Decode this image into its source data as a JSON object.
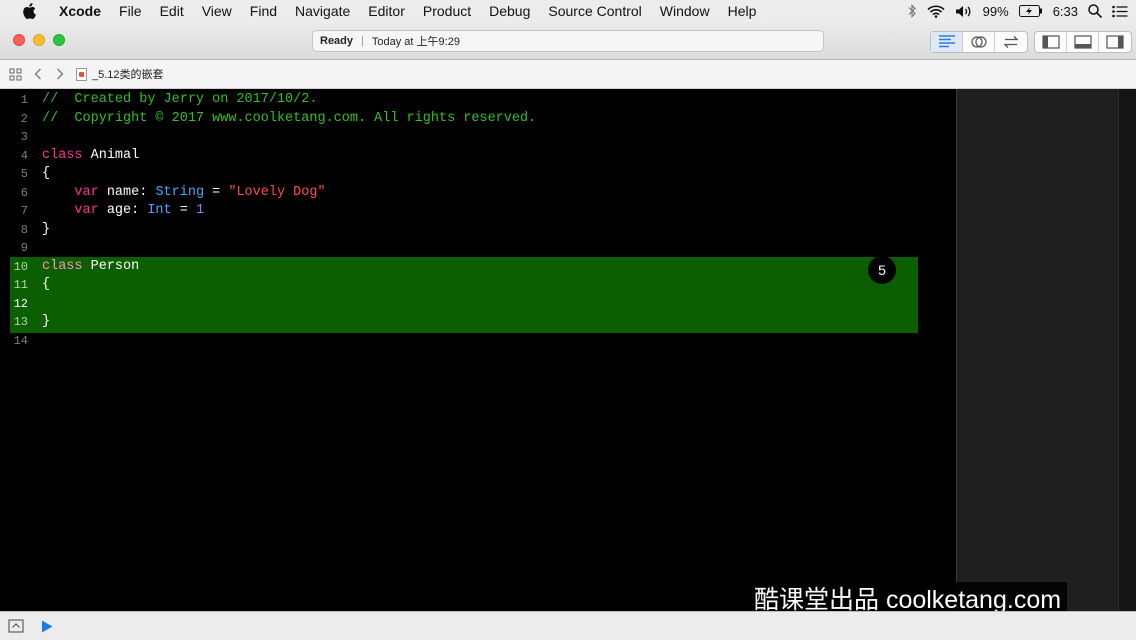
{
  "menubar": {
    "app_name": "Xcode",
    "items": [
      "File",
      "Edit",
      "View",
      "Find",
      "Navigate",
      "Editor",
      "Product",
      "Debug",
      "Source Control",
      "Window",
      "Help"
    ],
    "battery": "99%",
    "time": "6:33",
    "icons": [
      "apple-icon",
      "bluetooth-icon",
      "wifi-icon",
      "volume-icon",
      "battery-icon",
      "spotlight-icon",
      "notification-center-icon"
    ]
  },
  "toolbar": {
    "status": "Ready",
    "timestamp": "Today at 上午9:29",
    "editor_modes": [
      "standard-editor-icon",
      "assistant-editor-icon",
      "version-editor-icon"
    ],
    "panels": [
      "navigator-panel-icon",
      "debug-area-icon",
      "utilities-panel-icon"
    ]
  },
  "jumpbar": {
    "filename": "_5.12类的嵌套"
  },
  "editor": {
    "badge": "5",
    "lines": [
      {
        "n": "1",
        "tokens": [
          {
            "c": "cm",
            "t": "//  Created by Jerry on 2017/10/2."
          }
        ]
      },
      {
        "n": "2",
        "tokens": [
          {
            "c": "cm",
            "t": "//  Copyright © 2017 www.coolketang.com. All rights reserved."
          }
        ]
      },
      {
        "n": "3",
        "tokens": []
      },
      {
        "n": "4",
        "tokens": [
          {
            "c": "kw",
            "t": "class"
          },
          {
            "c": "",
            "t": " Animal"
          }
        ]
      },
      {
        "n": "5",
        "tokens": [
          {
            "c": "",
            "t": "{"
          }
        ]
      },
      {
        "n": "6",
        "tokens": [
          {
            "c": "",
            "t": "    "
          },
          {
            "c": "kw",
            "t": "var"
          },
          {
            "c": "",
            "t": " name: "
          },
          {
            "c": "ty",
            "t": "String"
          },
          {
            "c": "",
            "t": " = "
          },
          {
            "c": "st",
            "t": "\"Lovely Dog\""
          }
        ]
      },
      {
        "n": "7",
        "tokens": [
          {
            "c": "",
            "t": "    "
          },
          {
            "c": "kw",
            "t": "var"
          },
          {
            "c": "",
            "t": " age: "
          },
          {
            "c": "ty",
            "t": "Int"
          },
          {
            "c": "",
            "t": " = "
          },
          {
            "c": "nm",
            "t": "1"
          }
        ]
      },
      {
        "n": "8",
        "tokens": [
          {
            "c": "",
            "t": "}"
          }
        ]
      },
      {
        "n": "9",
        "tokens": []
      },
      {
        "n": "10",
        "hl": true,
        "tokens": [
          {
            "c": "kw-hl",
            "t": "class"
          },
          {
            "c": "",
            "t": " Person"
          }
        ]
      },
      {
        "n": "11",
        "hl": true,
        "tokens": [
          {
            "c": "",
            "t": "{"
          }
        ]
      },
      {
        "n": "12",
        "hl": true,
        "cur": true,
        "tokens": []
      },
      {
        "n": "13",
        "hl": true,
        "tokens": [
          {
            "c": "",
            "t": "}"
          }
        ]
      },
      {
        "n": "14",
        "tokens": []
      }
    ]
  },
  "watermark": "酷课堂出品 coolketang.com",
  "colors": {
    "highlight": "#0b5f00",
    "keyword": "#ff2f96",
    "comment": "#30c020",
    "type": "#3fa8ff",
    "string": "#ff4a4a",
    "number": "#8b84ff"
  }
}
